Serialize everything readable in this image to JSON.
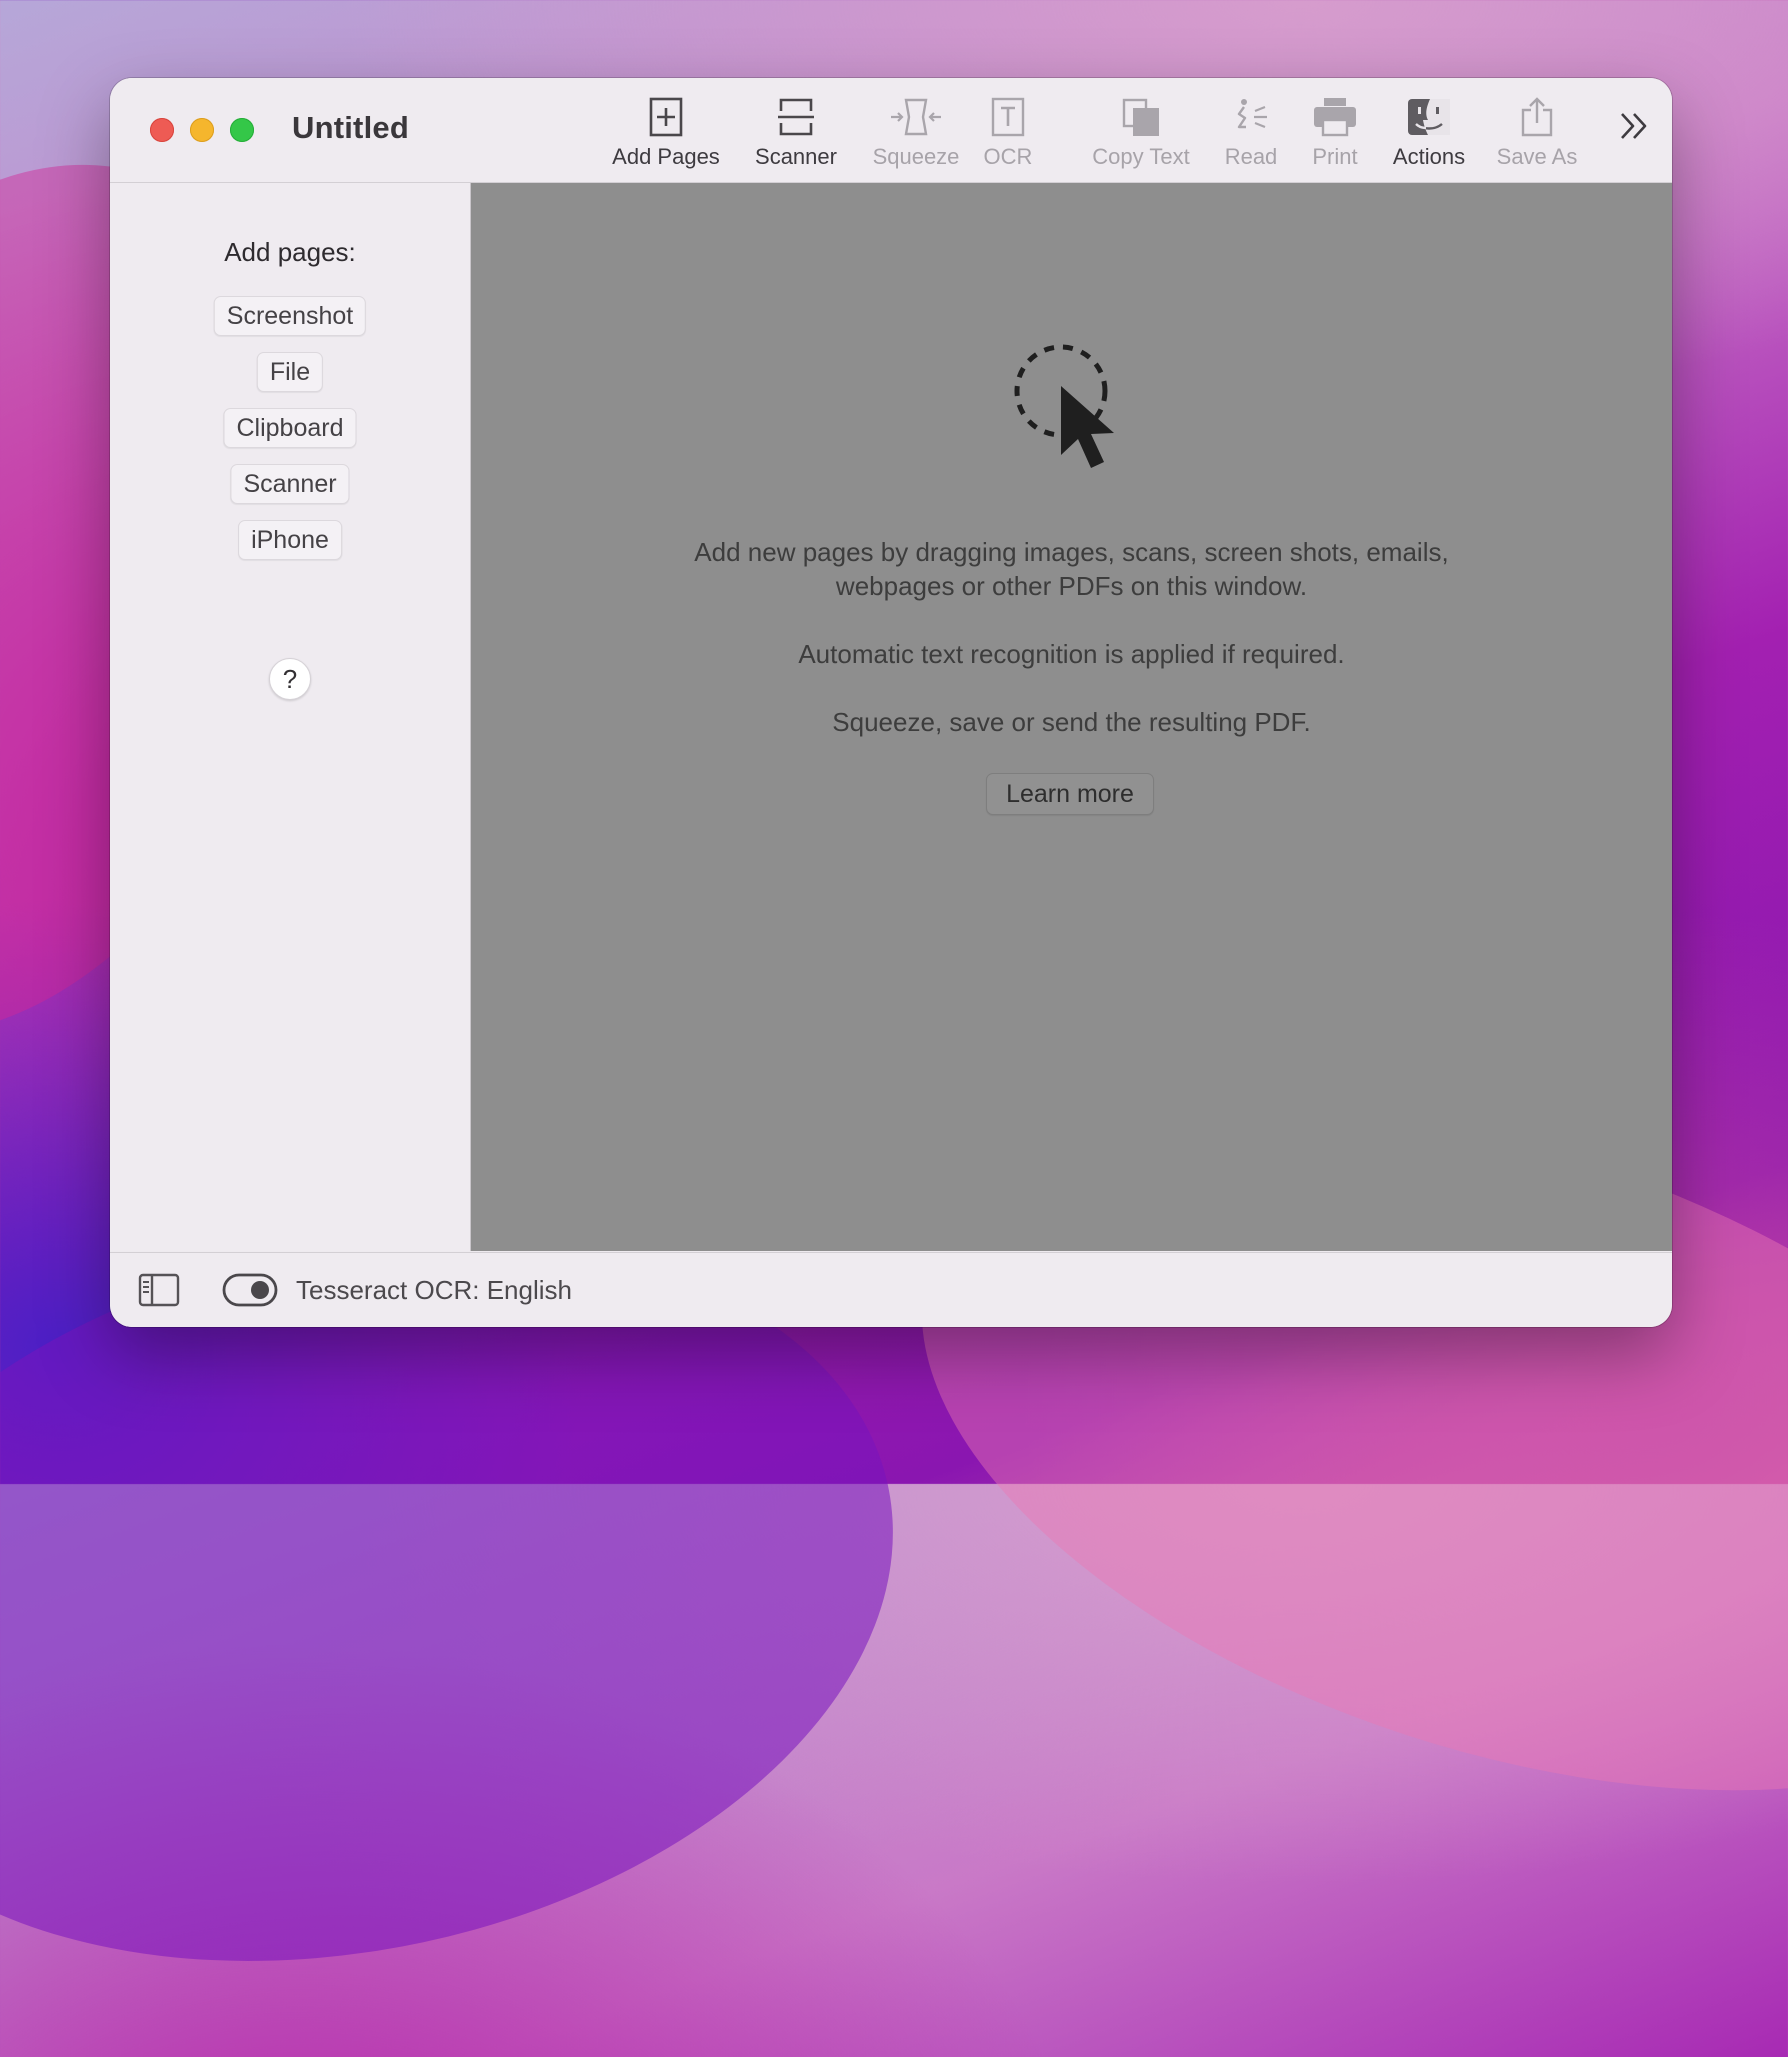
{
  "window": {
    "title": "Untitled"
  },
  "toolbar": {
    "items": [
      {
        "label": "Add Pages",
        "icon": "add-pages-icon",
        "enabled": true
      },
      {
        "label": "Scanner",
        "icon": "scanner-icon",
        "enabled": true
      },
      {
        "label": "Squeeze",
        "icon": "squeeze-icon",
        "enabled": false
      },
      {
        "label": "OCR",
        "icon": "ocr-icon",
        "enabled": false
      },
      {
        "label": "Copy Text",
        "icon": "copy-text-icon",
        "enabled": false
      },
      {
        "label": "Read",
        "icon": "read-icon",
        "enabled": false
      },
      {
        "label": "Print",
        "icon": "print-icon",
        "enabled": false
      },
      {
        "label": "Actions",
        "icon": "actions-icon",
        "enabled": true
      },
      {
        "label": "Save As",
        "icon": "save-as-icon",
        "enabled": false
      }
    ],
    "overflow_icon": "chevron-double-right-icon"
  },
  "sidebar": {
    "heading": "Add pages:",
    "buttons": [
      "Screenshot",
      "File",
      "Clipboard",
      "Scanner",
      "iPhone"
    ],
    "help_label": "?"
  },
  "main": {
    "icon": "drop-pointer-icon",
    "line1": "Add new pages by dragging images, scans, screen shots, emails,",
    "line2": "webpages or other PDFs on this window.",
    "line3": "Automatic text recognition is applied if required.",
    "line4": "Squeeze, save or send the resulting PDF.",
    "learn_more": "Learn more"
  },
  "statusbar": {
    "sidebar_icon": "sidebar-toggle-icon",
    "ocr_toggle_on": true,
    "ocr_status": "Tesseract OCR: English"
  },
  "colors": {
    "close": "#ee5b54",
    "minimize": "#f5b62d",
    "maximize": "#34c748",
    "content_background": "#8e8e8e",
    "chrome_background": "#efebf0"
  }
}
